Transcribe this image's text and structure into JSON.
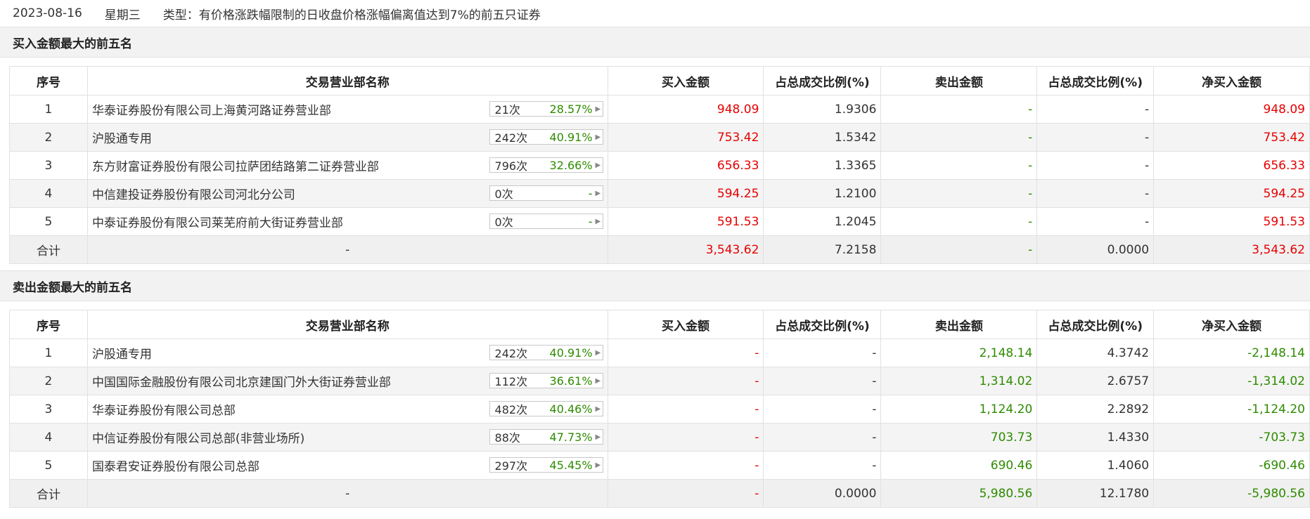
{
  "header": {
    "date": "2023-08-16",
    "weekday": "星期三",
    "type_text": "类型：有价格涨跌幅限制的日收盘价格涨幅偏离值达到7%的前五只证券"
  },
  "columns": [
    "序号",
    "交易营业部名称",
    "买入金额",
    "占总成交比例(%)",
    "卖出金额",
    "占总成交比例(%)",
    "净买入金额"
  ],
  "buy_section": {
    "title": "买入金额最大的前五名",
    "rows": [
      {
        "idx": "1",
        "name": "华泰证券股份有限公司上海黄河路证券营业部",
        "count": "21次",
        "pct": "28.57%",
        "buy": "948.09",
        "buy_ratio": "1.9306",
        "sell": "-",
        "sell_ratio": "-",
        "net": "948.09"
      },
      {
        "idx": "2",
        "name": "沪股通专用",
        "count": "242次",
        "pct": "40.91%",
        "buy": "753.42",
        "buy_ratio": "1.5342",
        "sell": "-",
        "sell_ratio": "-",
        "net": "753.42"
      },
      {
        "idx": "3",
        "name": "东方财富证券股份有限公司拉萨团结路第二证券营业部",
        "count": "796次",
        "pct": "32.66%",
        "buy": "656.33",
        "buy_ratio": "1.3365",
        "sell": "-",
        "sell_ratio": "-",
        "net": "656.33"
      },
      {
        "idx": "4",
        "name": "中信建投证券股份有限公司河北分公司",
        "count": "0次",
        "pct": "-",
        "buy": "594.25",
        "buy_ratio": "1.2100",
        "sell": "-",
        "sell_ratio": "-",
        "net": "594.25"
      },
      {
        "idx": "5",
        "name": "中泰证券股份有限公司莱芜府前大街证券营业部",
        "count": "0次",
        "pct": "-",
        "buy": "591.53",
        "buy_ratio": "1.2045",
        "sell": "-",
        "sell_ratio": "-",
        "net": "591.53"
      }
    ],
    "total": {
      "label": "合计",
      "name": "-",
      "buy": "3,543.62",
      "buy_ratio": "7.2158",
      "sell": "-",
      "sell_ratio": "0.0000",
      "net": "3,543.62"
    }
  },
  "sell_section": {
    "title": "卖出金额最大的前五名",
    "rows": [
      {
        "idx": "1",
        "name": "沪股通专用",
        "count": "242次",
        "pct": "40.91%",
        "buy": "-",
        "buy_ratio": "-",
        "sell": "2,148.14",
        "sell_ratio": "4.3742",
        "net": "-2,148.14"
      },
      {
        "idx": "2",
        "name": "中国国际金融股份有限公司北京建国门外大街证券营业部",
        "count": "112次",
        "pct": "36.61%",
        "buy": "-",
        "buy_ratio": "-",
        "sell": "1,314.02",
        "sell_ratio": "2.6757",
        "net": "-1,314.02"
      },
      {
        "idx": "3",
        "name": "华泰证券股份有限公司总部",
        "count": "482次",
        "pct": "40.46%",
        "buy": "-",
        "buy_ratio": "-",
        "sell": "1,124.20",
        "sell_ratio": "2.2892",
        "net": "-1,124.20"
      },
      {
        "idx": "4",
        "name": "中信证券股份有限公司总部(非营业场所)",
        "count": "88次",
        "pct": "47.73%",
        "buy": "-",
        "buy_ratio": "-",
        "sell": "703.73",
        "sell_ratio": "1.4330",
        "net": "-703.73"
      },
      {
        "idx": "5",
        "name": "国泰君安证券股份有限公司总部",
        "count": "297次",
        "pct": "45.45%",
        "buy": "-",
        "buy_ratio": "-",
        "sell": "690.46",
        "sell_ratio": "1.4060",
        "net": "-690.46"
      }
    ],
    "total": {
      "label": "合计",
      "name": "-",
      "buy": "-",
      "buy_ratio": "0.0000",
      "sell": "5,980.56",
      "sell_ratio": "12.1780",
      "net": "-5,980.56"
    }
  },
  "colors": {
    "red": "#e60000",
    "green": "#2e8b00",
    "row_alt": "#f4f4f4",
    "section_bg": "#f2f2f2"
  },
  "icons": {
    "badge_arrow": "triangle-right-icon"
  }
}
